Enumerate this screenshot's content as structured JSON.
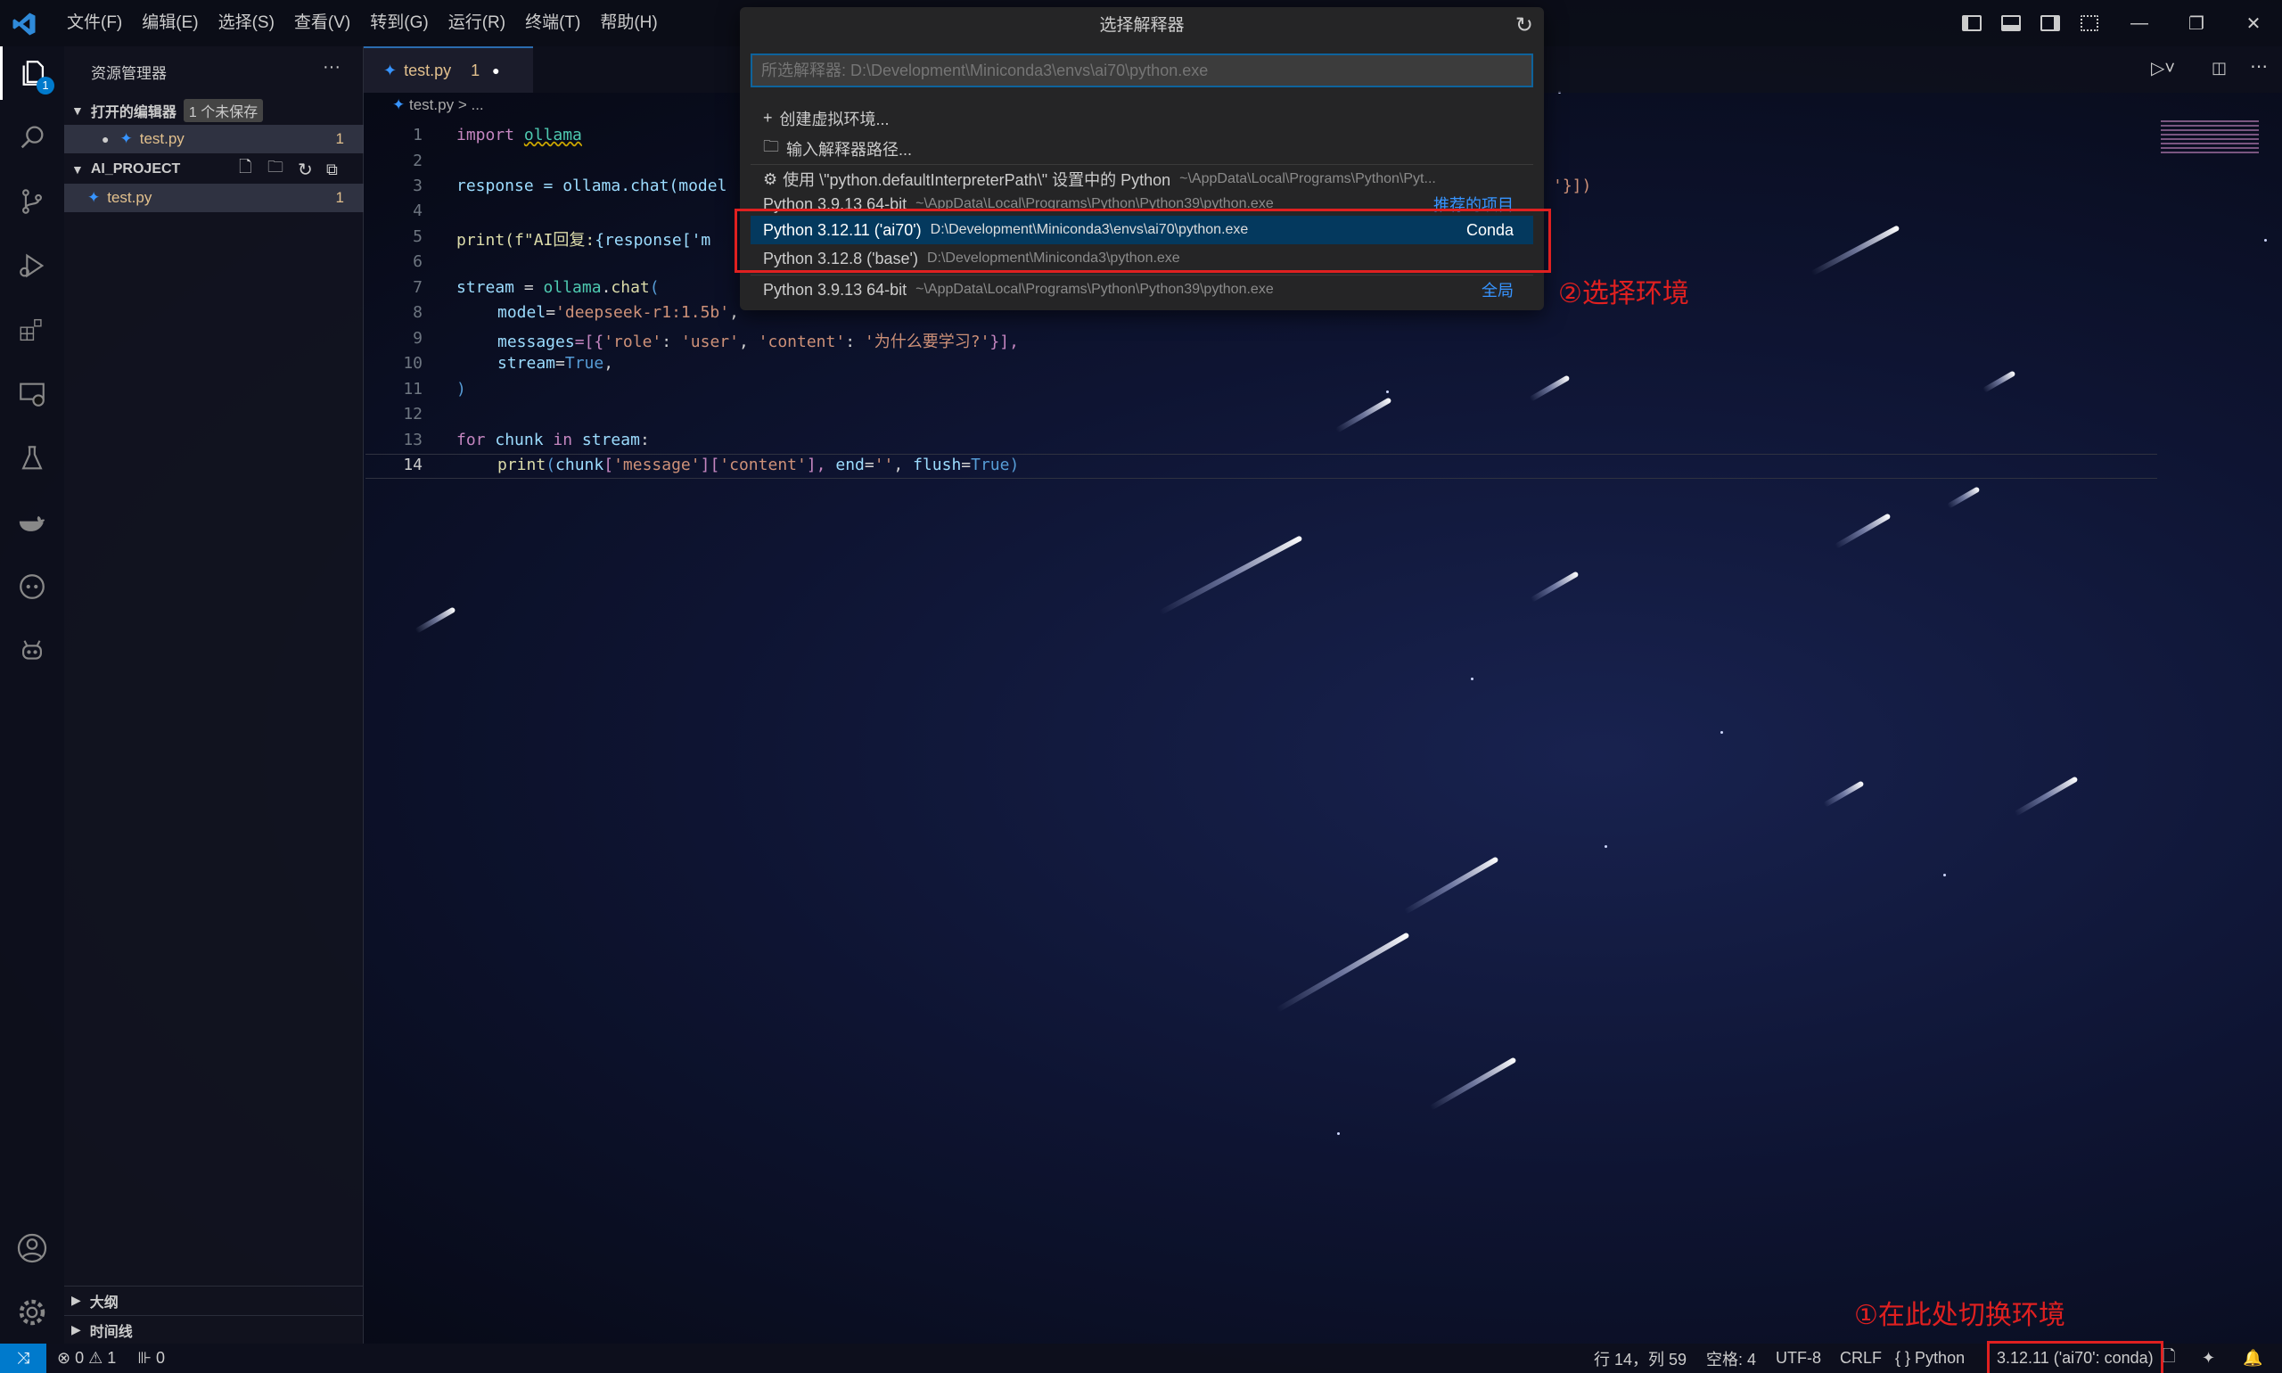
{
  "menu": [
    "文件(F)",
    "编辑(E)",
    "选择(S)",
    "查看(V)",
    "转到(G)",
    "运行(R)",
    "终端(T)",
    "帮助(H)"
  ],
  "sidebar": {
    "title": "资源管理器",
    "more": "···",
    "open_editors": "打开的编辑器",
    "unsaved_badge": "1 个未保存",
    "open_file": "test.py",
    "open_file_count": "1",
    "project": "AI_PROJECT",
    "project_file": "test.py",
    "project_file_count": "1",
    "outline": "大纲",
    "timeline": "时间线"
  },
  "activity_badge": "1",
  "tab": {
    "label": "test.py",
    "count": "1"
  },
  "breadcrumb": {
    "file": "test.py",
    "sep": ">",
    "rest": "..."
  },
  "code": {
    "lines": [
      "1",
      "2",
      "3",
      "4",
      "5",
      "6",
      "7",
      "8",
      "9",
      "10",
      "11",
      "12",
      "13",
      "14"
    ],
    "l1a": "import ",
    "l1b": "ollama",
    "l3a": "response = ollama.chat(model",
    "l3tail": "'}])",
    "l5a": "print(f\"AI回复:",
    "l5b": "{response['m",
    "l7a": "stream",
    "l7b": " = ",
    "l7c": "ollama",
    "l7d": ".",
    "l7e": "chat",
    "l7f": "(",
    "l8a": "model",
    "l8b": "=",
    "l8c": "'deepseek-r1:1.5b'",
    "l8d": ",",
    "l9a": "messages",
    "l9b": "=[{",
    "l9c": "'role'",
    "l9d": ": ",
    "l9e": "'user'",
    "l9f": ", ",
    "l9g": "'content'",
    "l9h": ": ",
    "l9i": "'为什么要学习?'",
    "l9j": "}],",
    "l10a": "stream",
    "l10b": "=",
    "l10c": "True",
    "l10d": ",",
    "l11": ")",
    "l13a": "for ",
    "l13b": "chunk",
    "l13c": " in ",
    "l13d": "stream",
    ":": ":",
    "l14a": "print",
    "l14b": "(",
    "l14c": "chunk",
    "l14d": "[",
    "l14e": "'message'",
    "l14f": "][",
    "l14g": "'content'",
    "l14h": "], ",
    "l14i": "end",
    "l14j": "=",
    "l14k": "''",
    "l14l": ", ",
    "l14m": "flush",
    "l14n": "=",
    "l14o": "True",
    "l14p": ")"
  },
  "quickpick": {
    "title": "选择解释器",
    "placeholder": "所选解释器: D:\\Development\\Miniconda3\\envs\\ai70\\python.exe",
    "create_env": "创建虚拟环境...",
    "enter_path": "输入解释器路径...",
    "default_path": "使用 \\\"python.defaultInterpreterPath\\\" 设置中的 Python",
    "default_path_desc": "~\\AppData\\Local\\Programs\\Python\\Pyt...",
    "recommended_name": "Python 3.9.13 64-bit",
    "recommended_desc": "~\\AppData\\Local\\Programs\\Python\\Python39\\python.exe",
    "recommended_tag": "推荐的项目",
    "ai70_name": "Python 3.12.11 ('ai70')",
    "ai70_desc": "D:\\Development\\Miniconda3\\envs\\ai70\\python.exe",
    "ai70_tag": "Conda",
    "base_name": "Python 3.12.8 ('base')",
    "base_desc": "D:\\Development\\Miniconda3\\python.exe",
    "global_name": "Python 3.9.13 64-bit",
    "global_desc": "~\\AppData\\Local\\Programs\\Python\\Python39\\python.exe",
    "global_tag": "全局"
  },
  "annotations": {
    "choose_env": "②选择环境",
    "switch_here": "①在此处切换环境"
  },
  "status": {
    "errors": "0",
    "warnings": "1",
    "ports": "0",
    "position": "行 14，列 59",
    "spaces": "空格: 4",
    "encoding": "UTF-8",
    "eol": "CRLF",
    "language": "Python",
    "interpreter": "3.12.11 ('ai70': conda)"
  },
  "colors": {
    "accent": "#007acc",
    "annotation": "#e02020",
    "selection": "#04395e"
  }
}
